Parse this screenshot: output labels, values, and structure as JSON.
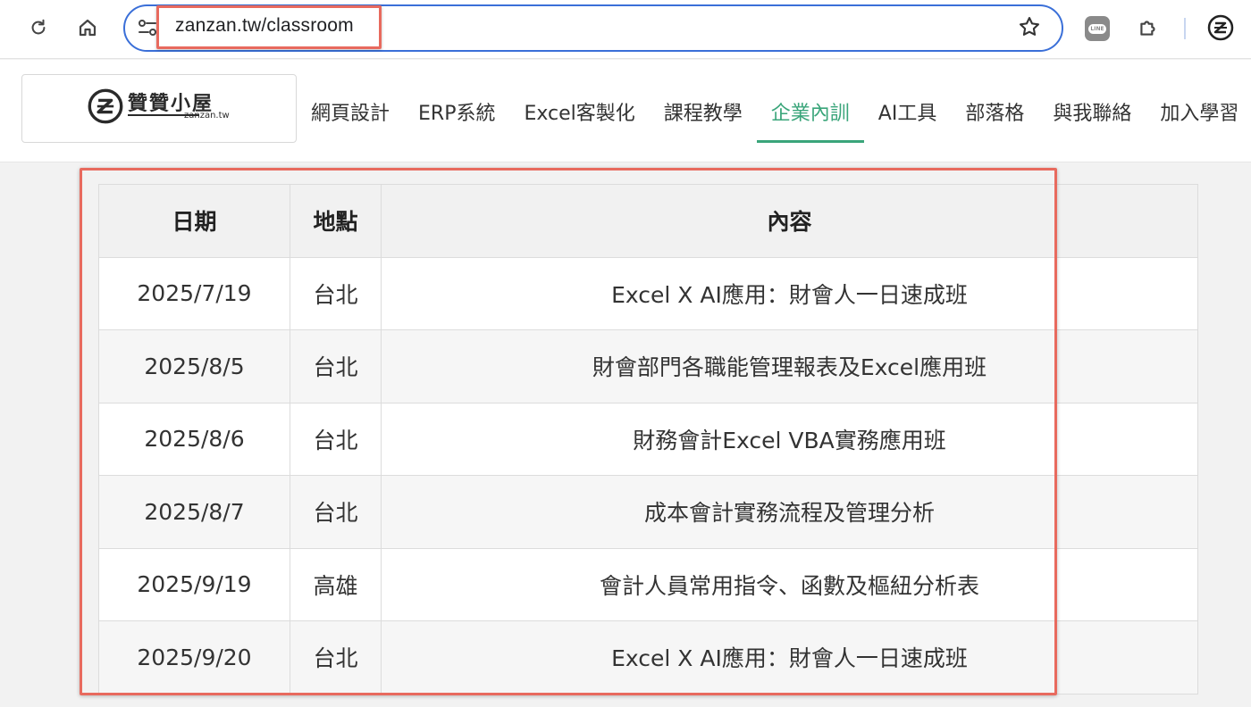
{
  "browser": {
    "url": "zanzan.tw/classroom",
    "icons": [
      "reload-icon",
      "home-icon",
      "site-settings-icon",
      "bookmark-star-icon",
      "line-extension-icon",
      "extensions-puzzle-icon",
      "profile-icon"
    ],
    "line_label": "LINE",
    "accent": "#3a6fd8"
  },
  "site": {
    "logo_title": "贊贊小屋",
    "logo_sub": "zanzan.tw",
    "nav": [
      {
        "label": "網頁設計",
        "active": false
      },
      {
        "label": "ERP系統",
        "active": false
      },
      {
        "label": "Excel客製化",
        "active": false
      },
      {
        "label": "課程教學",
        "active": false
      },
      {
        "label": "企業內訓",
        "active": true
      },
      {
        "label": "AI工具",
        "active": false
      },
      {
        "label": "部落格",
        "active": false
      },
      {
        "label": "與我聯絡",
        "active": false
      },
      {
        "label": "加入學習",
        "active": false
      }
    ],
    "active_color": "#3aa57a"
  },
  "table": {
    "headers": [
      "日期",
      "地點",
      "內容"
    ],
    "rows": [
      [
        "2025/7/19",
        "台北",
        "Excel X AI應用：財會人一日速成班"
      ],
      [
        "2025/8/5",
        "台北",
        "財會部門各職能管理報表及Excel應用班"
      ],
      [
        "2025/8/6",
        "台北",
        "財務會計Excel VBA實務應用班"
      ],
      [
        "2025/8/7",
        "台北",
        "成本會計實務流程及管理分析"
      ],
      [
        "2025/9/19",
        "高雄",
        "會計人員常用指令、函數及樞紐分析表"
      ],
      [
        "2025/9/20",
        "台北",
        "Excel X AI應用：財會人一日速成班"
      ]
    ]
  },
  "highlight_color": "#e86a5e"
}
